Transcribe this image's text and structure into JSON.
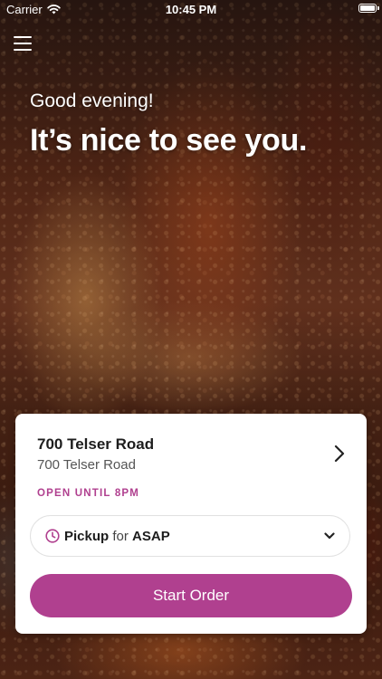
{
  "status_bar": {
    "carrier": "Carrier",
    "time": "10:45 PM"
  },
  "hero": {
    "greeting": "Good evening!",
    "headline": "It’s nice to see you."
  },
  "location_card": {
    "name": "700 Telser Road",
    "address": "700 Telser Road",
    "status": "OPEN UNTIL 8PM",
    "order_mode": {
      "mode": "Pickup",
      "connector": "for",
      "time": "ASAP"
    },
    "start_label": "Start Order"
  },
  "colors": {
    "accent": "#b0408f"
  },
  "icons": [
    "menu-icon",
    "wifi-icon",
    "battery-icon",
    "chevron-right-icon",
    "clock-icon",
    "chevron-down-icon"
  ]
}
